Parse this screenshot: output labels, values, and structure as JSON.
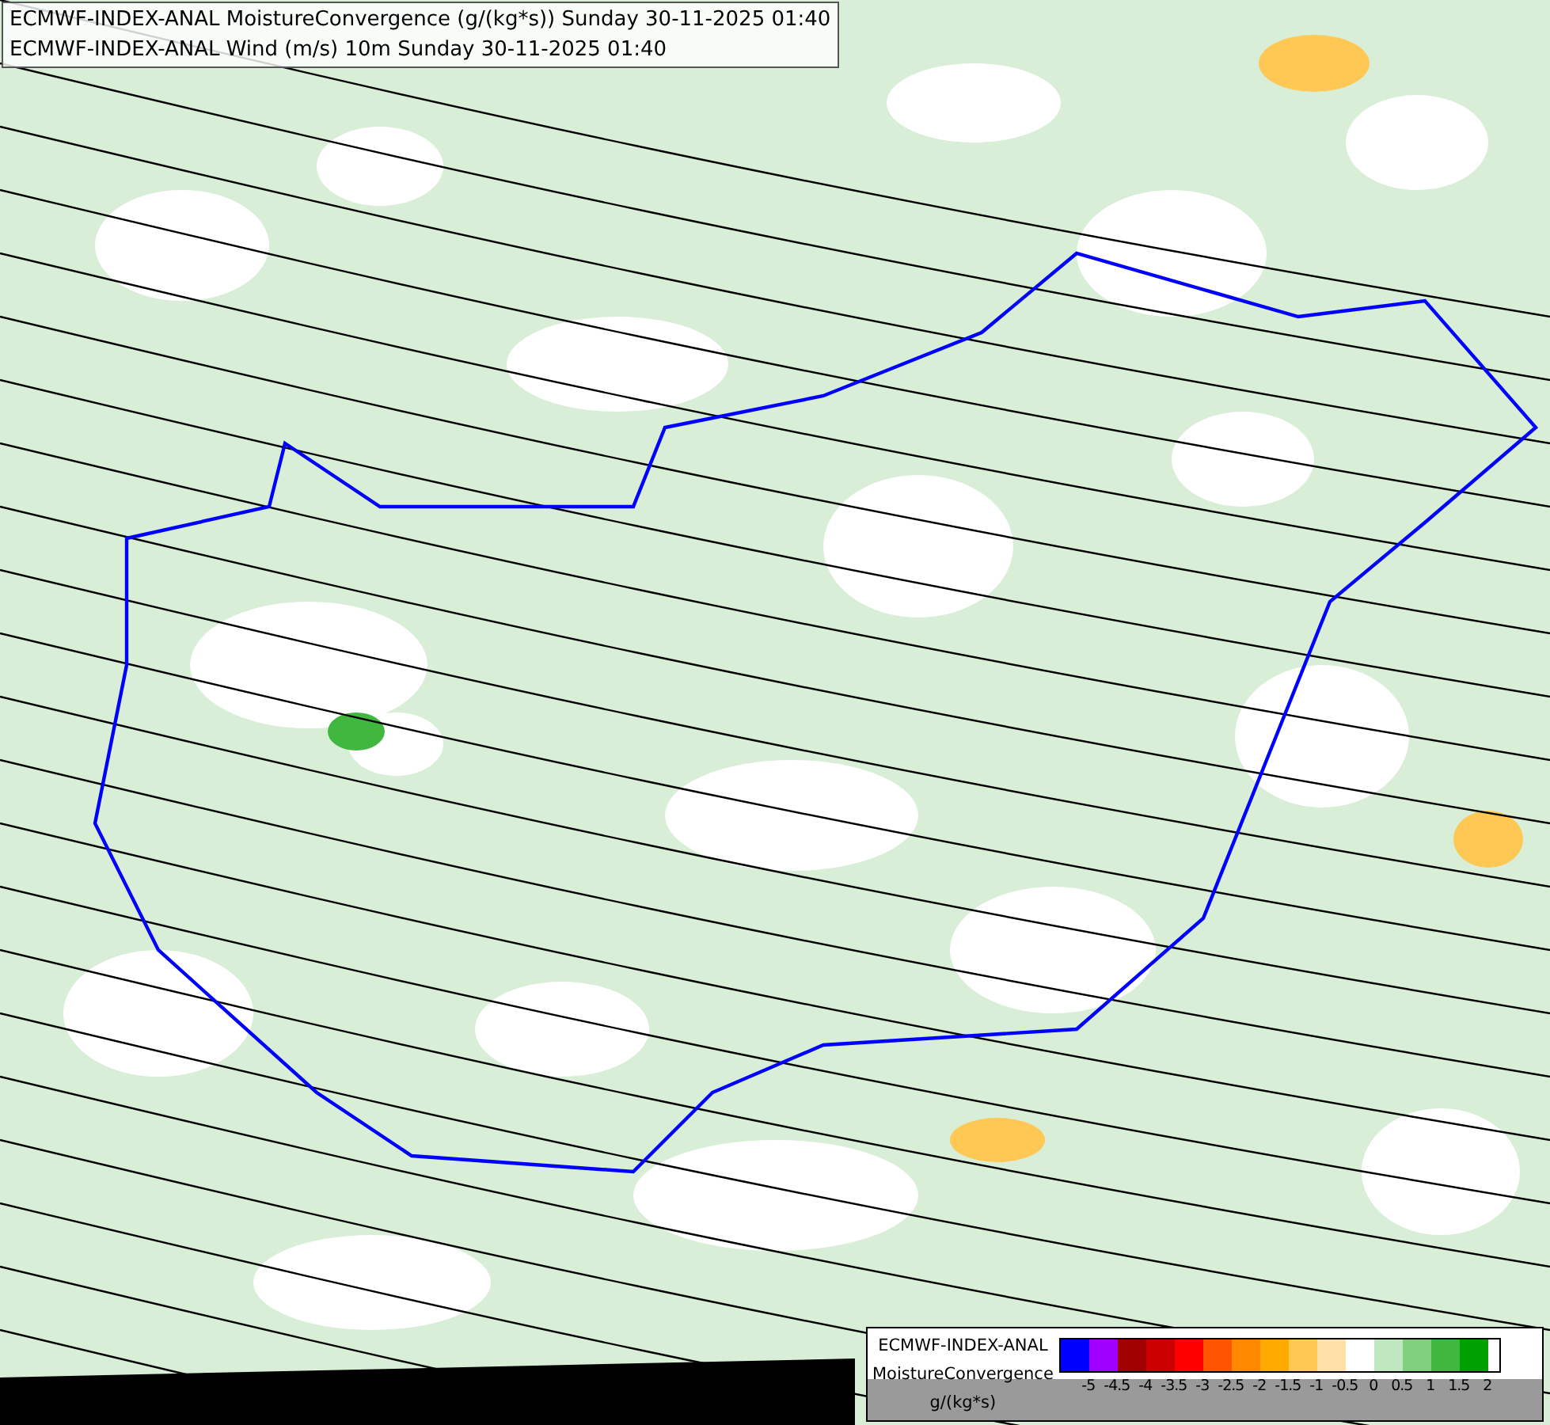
{
  "title_lines": [
    "ECMWF-INDEX-ANAL MoistureConvergence (g/(kg*s)) Sunday 30-11-2025 01:40",
    "ECMWF-INDEX-ANAL Wind (m/s) 10m Sunday 30-11-2025 01:40"
  ],
  "legend": {
    "source": "ECMWF-INDEX-ANAL",
    "parameter": "MoistureConvergence",
    "unit": "g/(kg*s)",
    "bins": [
      {
        "color": "#0000ff"
      },
      {
        "color": "#a000ff"
      },
      {
        "color": "#a00000"
      },
      {
        "color": "#cc0000"
      },
      {
        "color": "#ff0000"
      },
      {
        "color": "#ff5500"
      },
      {
        "color": "#ff8800"
      },
      {
        "color": "#ffaa00"
      },
      {
        "color": "#ffc855"
      },
      {
        "color": "#ffe0a8"
      },
      {
        "color": "#ffffff"
      },
      {
        "color": "#c0e8c0"
      },
      {
        "color": "#80d080"
      },
      {
        "color": "#40b840"
      },
      {
        "color": "#00a000"
      }
    ],
    "ticks": [
      "-5",
      "-4.5",
      "-4",
      "-3.5",
      "-3",
      "-2.5",
      "-2",
      "-1.5",
      "-1",
      "-0.5",
      "0",
      "0.5",
      "1",
      "1.5",
      "2"
    ]
  }
}
